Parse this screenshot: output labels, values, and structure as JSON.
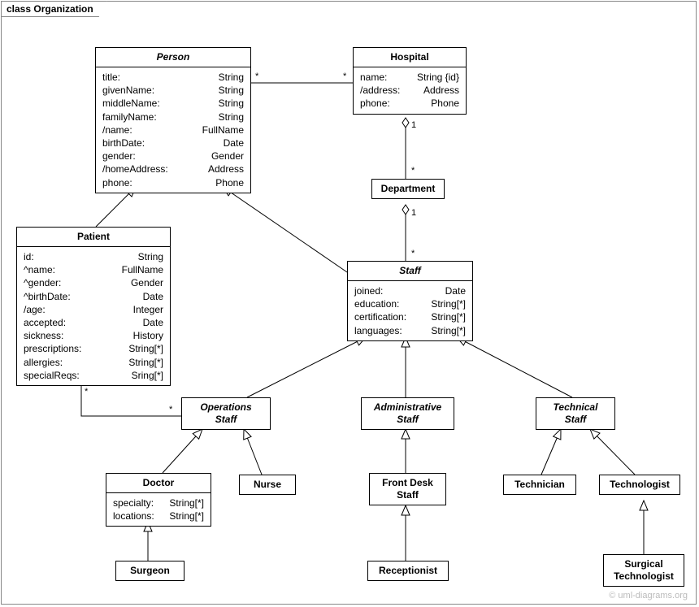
{
  "frame": {
    "title": "class Organization"
  },
  "watermark": "© uml-diagrams.org",
  "classes": {
    "person": {
      "name": "Person",
      "attrs": [
        [
          "title:",
          "String"
        ],
        [
          "givenName:",
          "String"
        ],
        [
          "middleName:",
          "String"
        ],
        [
          "familyName:",
          "String"
        ],
        [
          "/name:",
          "FullName"
        ],
        [
          "birthDate:",
          "Date"
        ],
        [
          "gender:",
          "Gender"
        ],
        [
          "/homeAddress:",
          "Address"
        ],
        [
          "phone:",
          "Phone"
        ]
      ]
    },
    "hospital": {
      "name": "Hospital",
      "attrs": [
        [
          "name:",
          "String {id}"
        ],
        [
          "/address:",
          "Address"
        ],
        [
          "phone:",
          "Phone"
        ]
      ]
    },
    "department": {
      "name": "Department"
    },
    "patient": {
      "name": "Patient",
      "attrs": [
        [
          "id:",
          "String"
        ],
        [
          "^name:",
          "FullName"
        ],
        [
          "^gender:",
          "Gender"
        ],
        [
          "^birthDate:",
          "Date"
        ],
        [
          "/age:",
          "Integer"
        ],
        [
          "accepted:",
          "Date"
        ],
        [
          "sickness:",
          "History"
        ],
        [
          "prescriptions:",
          "String[*]"
        ],
        [
          "allergies:",
          "String[*]"
        ],
        [
          "specialReqs:",
          "Sring[*]"
        ]
      ]
    },
    "staff": {
      "name": "Staff",
      "attrs": [
        [
          "joined:",
          "Date"
        ],
        [
          "education:",
          "String[*]"
        ],
        [
          "certification:",
          "String[*]"
        ],
        [
          "languages:",
          "String[*]"
        ]
      ]
    },
    "opsStaff": {
      "name": "Operations\nStaff"
    },
    "adminStaff": {
      "name": "Administrative\nStaff"
    },
    "techStaff": {
      "name": "Technical\nStaff"
    },
    "doctor": {
      "name": "Doctor",
      "attrs": [
        [
          "specialty:",
          "String[*]"
        ],
        [
          "locations:",
          "String[*]"
        ]
      ]
    },
    "nurse": {
      "name": "Nurse"
    },
    "frontDesk": {
      "name": "Front Desk\nStaff"
    },
    "technician": {
      "name": "Technician"
    },
    "technologist": {
      "name": "Technologist"
    },
    "surgeon": {
      "name": "Surgeon"
    },
    "receptionist": {
      "name": "Receptionist"
    },
    "surgTech": {
      "name": "Surgical\nTechnologist"
    }
  },
  "mult": {
    "personHospL": "*",
    "personHospR": "*",
    "hospDeptTop": "1",
    "hospDeptBot": "*",
    "deptStaffTop": "1",
    "deptStaffBot": "*",
    "patientOpsL": "*",
    "patientOpsR": "*"
  }
}
